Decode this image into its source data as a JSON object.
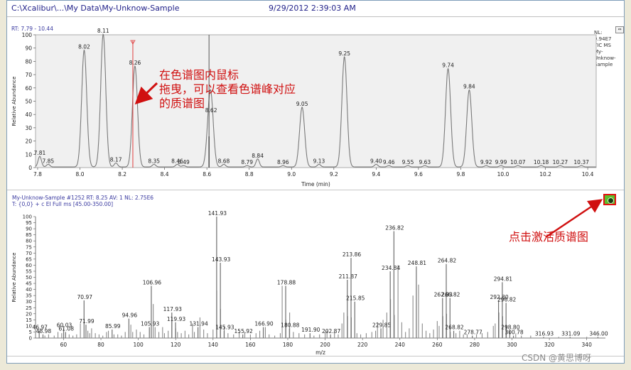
{
  "header": {
    "path": "C:\\Xcalibur\\...\\My Data\\My-Unknow-Sample",
    "datetime": "9/29/2012 2:39:03 AM"
  },
  "tic_panel": {
    "rt_range": "RT: 7.79 - 10.44",
    "info_lines": [
      "NL:",
      "9.94E7",
      "TIC  MS",
      "My-",
      "Unknow-",
      "Sample"
    ],
    "corner_button": "⇔"
  },
  "ms_panel": {
    "header_line1": "My-Unknow-Sample #1252   RT: 8.25   AV: 1   NL: 2.75E6",
    "header_line2": "T: {0,0}  + c EI Full ms [45.00-350.00]"
  },
  "annotations": {
    "drag_note": [
      "在色谱图内鼠标",
      "拖曳，可以查看色谱峰对应",
      "的质谱图"
    ],
    "activate_note": "点击激活质谱图"
  },
  "watermark": "CSDN @黄思博呀",
  "colors": {
    "accent_red": "#d01010",
    "trace_gray": "#7a7a7a",
    "activate_green": "#5cbf2a"
  },
  "chart_data": [
    {
      "type": "line",
      "title": "",
      "xlabel": "Time (min)",
      "ylabel": "Relative Abundance",
      "xlim": [
        7.79,
        10.44
      ],
      "ylim": [
        0,
        100
      ],
      "x_ticks": [
        "7.8",
        "8.0",
        "8.2",
        "8.4",
        "8.6",
        "8.8",
        "9.0",
        "9.2",
        "9.4",
        "9.6",
        "9.8",
        "10.0",
        "10.2",
        "10.4"
      ],
      "y_ticks": [
        "0",
        "10",
        "20",
        "30",
        "40",
        "50",
        "60",
        "70",
        "80",
        "90",
        "100"
      ],
      "peaks": [
        {
          "rt": 7.81,
          "height": 8,
          "label": "7.81"
        },
        {
          "rt": 7.85,
          "height": 2,
          "label": "7.85"
        },
        {
          "rt": 8.02,
          "height": 88,
          "label": "8.02"
        },
        {
          "rt": 8.11,
          "height": 100,
          "label": "8.11"
        },
        {
          "rt": 8.17,
          "height": 3,
          "label": "8.17"
        },
        {
          "rt": 8.26,
          "height": 76,
          "label": "8.26"
        },
        {
          "rt": 8.35,
          "height": 2,
          "label": "8.35"
        },
        {
          "rt": 8.46,
          "height": 2,
          "label": "8.46"
        },
        {
          "rt": 8.49,
          "height": 1,
          "label": "8.49"
        },
        {
          "rt": 8.61,
          "height": 23,
          "label": ""
        },
        {
          "rt": 8.62,
          "height": 40,
          "label": "8.62"
        },
        {
          "rt": 8.68,
          "height": 2,
          "label": "8.68"
        },
        {
          "rt": 8.79,
          "height": 1,
          "label": "8.79"
        },
        {
          "rt": 8.84,
          "height": 6,
          "label": "8.84"
        },
        {
          "rt": 8.96,
          "height": 1,
          "label": "8.96"
        },
        {
          "rt": 9.05,
          "height": 45,
          "label": "9.05"
        },
        {
          "rt": 9.13,
          "height": 2,
          "label": "9.13"
        },
        {
          "rt": 9.25,
          "height": 83,
          "label": "9.25"
        },
        {
          "rt": 9.4,
          "height": 2,
          "label": "9.40"
        },
        {
          "rt": 9.46,
          "height": 1,
          "label": "9.46"
        },
        {
          "rt": 9.55,
          "height": 1,
          "label": "9.55"
        },
        {
          "rt": 9.63,
          "height": 1,
          "label": "9.63"
        },
        {
          "rt": 9.74,
          "height": 74,
          "label": "9.74"
        },
        {
          "rt": 9.84,
          "height": 58,
          "label": "9.84"
        },
        {
          "rt": 9.92,
          "height": 1,
          "label": "9.92"
        },
        {
          "rt": 9.99,
          "height": 1,
          "label": "9.99"
        },
        {
          "rt": 10.07,
          "height": 1,
          "label": "10.07"
        },
        {
          "rt": 10.18,
          "height": 1,
          "label": "10.18"
        },
        {
          "rt": 10.27,
          "height": 1,
          "label": "10.27"
        },
        {
          "rt": 10.37,
          "height": 1,
          "label": "10.37"
        }
      ],
      "cursor_rt": 8.25
    },
    {
      "type": "bar",
      "title": "",
      "xlabel": "m/z",
      "ylabel": "Relative Abundance",
      "xlim": [
        45,
        350
      ],
      "ylim": [
        0,
        100
      ],
      "x_ticks": [
        "60",
        "80",
        "100",
        "120",
        "140",
        "160",
        "180",
        "200",
        "220",
        "240",
        "260",
        "280",
        "300",
        "320",
        "340"
      ],
      "y_ticks": [
        "0",
        "5",
        "10",
        "15",
        "20",
        "25",
        "30",
        "35",
        "40",
        "45",
        "50",
        "55",
        "60",
        "65",
        "70",
        "75",
        "80",
        "85",
        "90",
        "95",
        "100"
      ],
      "labeled_peaks": [
        {
          "mz": 46.97,
          "intensity": 6,
          "label": "46.97"
        },
        {
          "mz": 48.98,
          "intensity": 3,
          "label": "48.98"
        },
        {
          "mz": 60.03,
          "intensity": 8,
          "label": "60.03"
        },
        {
          "mz": 61.08,
          "intensity": 5,
          "label": "61.08"
        },
        {
          "mz": 70.97,
          "intensity": 31,
          "label": "70.97"
        },
        {
          "mz": 71.99,
          "intensity": 11,
          "label": "71.99"
        },
        {
          "mz": 85.99,
          "intensity": 7,
          "label": "85.99"
        },
        {
          "mz": 94.96,
          "intensity": 16,
          "label": "94.96"
        },
        {
          "mz": 105.93,
          "intensity": 9,
          "label": "105.93"
        },
        {
          "mz": 106.96,
          "intensity": 43,
          "label": "106.96"
        },
        {
          "mz": 117.93,
          "intensity": 21,
          "label": "117.93"
        },
        {
          "mz": 119.93,
          "intensity": 13,
          "label": "119.93"
        },
        {
          "mz": 131.94,
          "intensity": 9,
          "label": "131.94"
        },
        {
          "mz": 141.93,
          "intensity": 100,
          "label": "141.93"
        },
        {
          "mz": 143.93,
          "intensity": 62,
          "label": "143.93"
        },
        {
          "mz": 145.93,
          "intensity": 6,
          "label": "145.93"
        },
        {
          "mz": 155.92,
          "intensity": 3,
          "label": "155.92"
        },
        {
          "mz": 166.9,
          "intensity": 9,
          "label": "166.90"
        },
        {
          "mz": 178.88,
          "intensity": 43,
          "label": "178.88"
        },
        {
          "mz": 180.88,
          "intensity": 8,
          "label": "180.88"
        },
        {
          "mz": 191.9,
          "intensity": 4,
          "label": "191.90"
        },
        {
          "mz": 202.87,
          "intensity": 3,
          "label": "202.87"
        },
        {
          "mz": 211.87,
          "intensity": 48,
          "label": "211.87"
        },
        {
          "mz": 213.86,
          "intensity": 66,
          "label": "213.86"
        },
        {
          "mz": 215.85,
          "intensity": 30,
          "label": "215.85"
        },
        {
          "mz": 229.85,
          "intensity": 8,
          "label": "229.85"
        },
        {
          "mz": 234.84,
          "intensity": 55,
          "label": "234.84"
        },
        {
          "mz": 236.82,
          "intensity": 88,
          "label": "236.82"
        },
        {
          "mz": 248.81,
          "intensity": 59,
          "label": "248.81"
        },
        {
          "mz": 262.83,
          "intensity": 33,
          "label": "262.83"
        },
        {
          "mz": 264.82,
          "intensity": 61,
          "label": "264.82"
        },
        {
          "mz": 266.82,
          "intensity": 33,
          "label": "266.82"
        },
        {
          "mz": 268.82,
          "intensity": 6,
          "label": "268.82"
        },
        {
          "mz": 278.77,
          "intensity": 2,
          "label": "278.77"
        },
        {
          "mz": 292.8,
          "intensity": 31,
          "label": "292.80"
        },
        {
          "mz": 294.81,
          "intensity": 46,
          "label": "294.81"
        },
        {
          "mz": 296.82,
          "intensity": 29,
          "label": "296.82"
        },
        {
          "mz": 298.8,
          "intensity": 6,
          "label": "298.80"
        },
        {
          "mz": 300.78,
          "intensity": 2,
          "label": "300.78"
        },
        {
          "mz": 316.93,
          "intensity": 1,
          "label": "316.93"
        },
        {
          "mz": 331.09,
          "intensity": 1,
          "label": "331.09"
        },
        {
          "mz": 346.0,
          "intensity": 1,
          "label": "346.00"
        }
      ],
      "unlabeled_peaks": [
        [
          50,
          2
        ],
        [
          52,
          3
        ],
        [
          55,
          2
        ],
        [
          57,
          5
        ],
        [
          59,
          4
        ],
        [
          63,
          3
        ],
        [
          65,
          2
        ],
        [
          67,
          3
        ],
        [
          69,
          12
        ],
        [
          73,
          6
        ],
        [
          74,
          4
        ],
        [
          75,
          8
        ],
        [
          77,
          4
        ],
        [
          79,
          3
        ],
        [
          81,
          2
        ],
        [
          83,
          5
        ],
        [
          84,
          6
        ],
        [
          87,
          3
        ],
        [
          89,
          3
        ],
        [
          91,
          2
        ],
        [
          93,
          5
        ],
        [
          96,
          11
        ],
        [
          97,
          5
        ],
        [
          99,
          7
        ],
        [
          101,
          5
        ],
        [
          103,
          3
        ],
        [
          108,
          28
        ],
        [
          109,
          9
        ],
        [
          111,
          5
        ],
        [
          113,
          9
        ],
        [
          114,
          4
        ],
        [
          116,
          6
        ],
        [
          118,
          17
        ],
        [
          120,
          8
        ],
        [
          121,
          5
        ],
        [
          123,
          4
        ],
        [
          125,
          6
        ],
        [
          127,
          3
        ],
        [
          129,
          12
        ],
        [
          130,
          5
        ],
        [
          133,
          17
        ],
        [
          135,
          7
        ],
        [
          137,
          4
        ],
        [
          140,
          7
        ],
        [
          142,
          39
        ],
        [
          144,
          24
        ],
        [
          146,
          10
        ],
        [
          148,
          4
        ],
        [
          151,
          3
        ],
        [
          154,
          5
        ],
        [
          157,
          5
        ],
        [
          160,
          3
        ],
        [
          163,
          4
        ],
        [
          165,
          6
        ],
        [
          168,
          9
        ],
        [
          170,
          3
        ],
        [
          173,
          2
        ],
        [
          176,
          4
        ],
        [
          177,
          43
        ],
        [
          179,
          15
        ],
        [
          181,
          21
        ],
        [
          183,
          5
        ],
        [
          186,
          4
        ],
        [
          189,
          3
        ],
        [
          194,
          2
        ],
        [
          197,
          3
        ],
        [
          200,
          5
        ],
        [
          201,
          6
        ],
        [
          205,
          5
        ],
        [
          207,
          3
        ],
        [
          209,
          12
        ],
        [
          210,
          21
        ],
        [
          212,
          18
        ],
        [
          214,
          17
        ],
        [
          217,
          4
        ],
        [
          219,
          3
        ],
        [
          222,
          4
        ],
        [
          225,
          5
        ],
        [
          227,
          6
        ],
        [
          228,
          13
        ],
        [
          231,
          15
        ],
        [
          233,
          21
        ],
        [
          235,
          32
        ],
        [
          237,
          19
        ],
        [
          239,
          60
        ],
        [
          241,
          13
        ],
        [
          243,
          5
        ],
        [
          245,
          8
        ],
        [
          247,
          35
        ],
        [
          250,
          44
        ],
        [
          252,
          12
        ],
        [
          254,
          6
        ],
        [
          256,
          4
        ],
        [
          258,
          7
        ],
        [
          260,
          14
        ],
        [
          261,
          10
        ],
        [
          263,
          18
        ],
        [
          265,
          20
        ],
        [
          267,
          5
        ],
        [
          270,
          4
        ],
        [
          272,
          6
        ],
        [
          274,
          3
        ],
        [
          276,
          3
        ],
        [
          281,
          3
        ],
        [
          284,
          4
        ],
        [
          287,
          5
        ],
        [
          290,
          10
        ],
        [
          291,
          12
        ],
        [
          293,
          21
        ],
        [
          295,
          18
        ],
        [
          297,
          10
        ],
        [
          302,
          3
        ],
        [
          305,
          2
        ],
        [
          310,
          2
        ],
        [
          325,
          1
        ],
        [
          340,
          1
        ]
      ]
    }
  ]
}
